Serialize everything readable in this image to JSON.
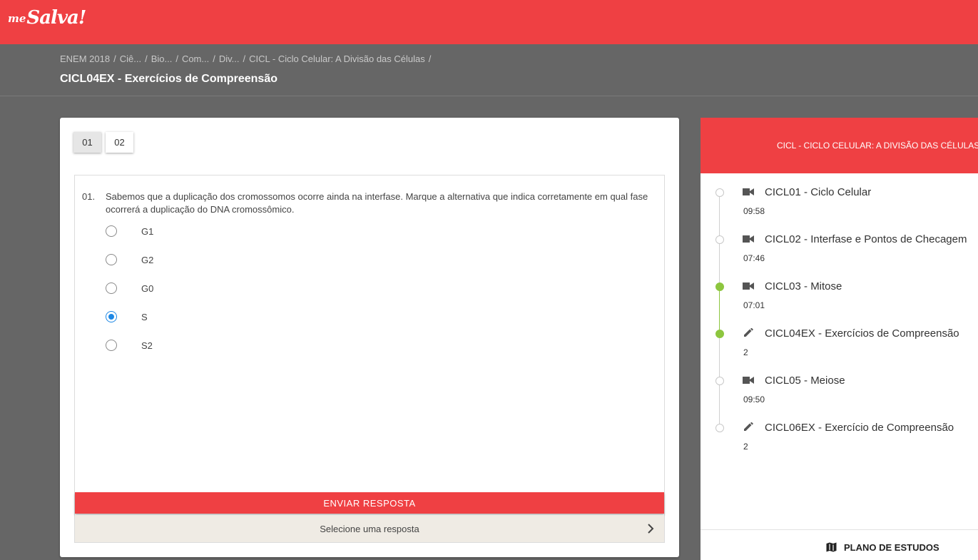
{
  "app": {
    "logo_prefix": "me",
    "logo_main": "Salva!"
  },
  "breadcrumb": [
    "ENEM 2018",
    "Ciê...",
    "Bio...",
    "Com...",
    "Div...",
    "CICL - Ciclo Celular: A Divisão das Células"
  ],
  "breadcrumb_separator": "/",
  "page_title": "CICL04EX - Exercícios de Compreensão",
  "question_tabs": [
    {
      "label": "01",
      "active": true
    },
    {
      "label": "02",
      "active": false
    }
  ],
  "question": {
    "number": "01.",
    "text": "Sabemos que a duplicação dos cromossomos ocorre ainda na interfase. Marque a alternativa que indica corretamente em qual fase ocorrerá a duplicação do DNA cromossômico.",
    "options": [
      {
        "label": "G1",
        "selected": false
      },
      {
        "label": "G2",
        "selected": false
      },
      {
        "label": "G0",
        "selected": false
      },
      {
        "label": "S",
        "selected": true
      },
      {
        "label": "S2",
        "selected": false
      }
    ],
    "submit_label": "ENVIAR RESPOSTA",
    "hint": "Selecione uma resposta"
  },
  "sidebar": {
    "header": "CICL - CICLO CELULAR: A DIVISÃO DAS CÉLULAS",
    "items": [
      {
        "icon": "video-icon",
        "title": "CICL01 - Ciclo Celular",
        "meta": "09:58",
        "done": false
      },
      {
        "icon": "video-icon",
        "title": "CICL02 - Interfase e Pontos de Checagem",
        "meta": "07:46",
        "done": false
      },
      {
        "icon": "video-icon",
        "title": "CICL03 - Mitose",
        "meta": "07:01",
        "done": true
      },
      {
        "icon": "pencil-icon",
        "title": "CICL04EX - Exercícios de Compreensão",
        "meta": "2",
        "done": true
      },
      {
        "icon": "video-icon",
        "title": "CICL05 - Meiose",
        "meta": "09:50",
        "done": false
      },
      {
        "icon": "pencil-icon",
        "title": "CICL06EX - Exercício de Compreensão",
        "meta": "2",
        "done": false
      }
    ],
    "footer_label": "PLANO DE ESTUDOS",
    "footer_icon": "map-icon"
  },
  "colors": {
    "brand": "#ef4043",
    "background": "#666666",
    "done": "#8dc63f",
    "radio_selected": "#1e88e5"
  }
}
